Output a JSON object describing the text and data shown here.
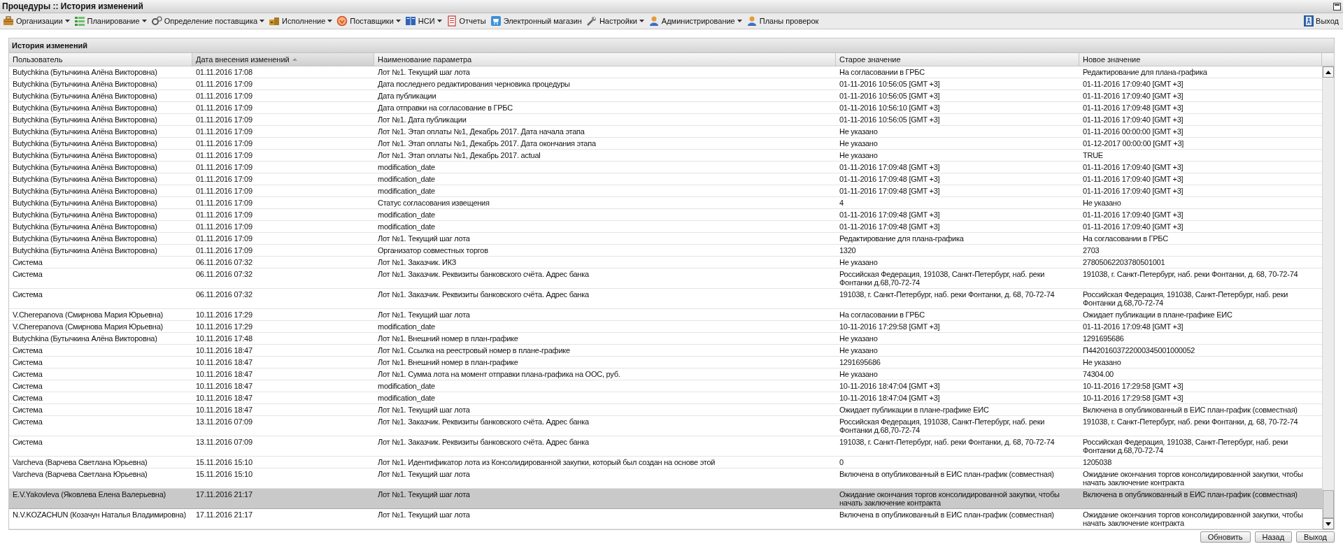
{
  "window": {
    "title": "Процедуры :: История изменений"
  },
  "toolbar": {
    "items": [
      {
        "label": "Организации",
        "dropdown": true
      },
      {
        "label": "Планирование",
        "dropdown": true
      },
      {
        "label": "Определение поставщика",
        "dropdown": true
      },
      {
        "label": "Исполнение",
        "dropdown": true
      },
      {
        "label": "Поставщики",
        "dropdown": true
      },
      {
        "label": "НСИ",
        "dropdown": true
      },
      {
        "label": "Отчеты",
        "dropdown": false
      },
      {
        "label": "Электронный магазин",
        "dropdown": false
      },
      {
        "label": "Настройки",
        "dropdown": true
      },
      {
        "label": "Администрирование",
        "dropdown": true
      },
      {
        "label": "Планы проверок",
        "dropdown": false
      }
    ],
    "exit": "Выход"
  },
  "panel": {
    "title": "История изменений"
  },
  "table": {
    "columns": [
      {
        "label": "Пользователь",
        "sorted": false
      },
      {
        "label": "Дата внесения изменений",
        "sorted": true
      },
      {
        "label": "Наименование параметра",
        "sorted": false
      },
      {
        "label": "Старое значение",
        "sorted": false
      },
      {
        "label": "Новое значение",
        "sorted": false
      }
    ],
    "rows": [
      {
        "user": "Butychkina (Бутычкина Алёна Викторовна)",
        "date": "01.11.2016 17:08",
        "parameter": "Лот №1. Текущий шаг лота",
        "old_value": "На согласовании в ГРБС",
        "new_value": "Редактирование для плана-графика",
        "selected": false
      },
      {
        "user": "Butychkina (Бутычкина Алёна Викторовна)",
        "date": "01.11.2016 17:09",
        "parameter": "Дата последнего редактирования черновика процедуры",
        "old_value": "01-11-2016 10:56:05 [GMT +3]",
        "new_value": "01-11-2016 17:09:40 [GMT +3]",
        "selected": false
      },
      {
        "user": "Butychkina (Бутычкина Алёна Викторовна)",
        "date": "01.11.2016 17:09",
        "parameter": "Дата публикации",
        "old_value": "01-11-2016 10:56:05 [GMT +3]",
        "new_value": "01-11-2016 17:09:40 [GMT +3]",
        "selected": false
      },
      {
        "user": "Butychkina (Бутычкина Алёна Викторовна)",
        "date": "01.11.2016 17:09",
        "parameter": "Дата отправки на согласование в ГРБС",
        "old_value": "01-11-2016 10:56:10 [GMT +3]",
        "new_value": "01-11-2016 17:09:48 [GMT +3]",
        "selected": false
      },
      {
        "user": "Butychkina (Бутычкина Алёна Викторовна)",
        "date": "01.11.2016 17:09",
        "parameter": "Лот №1. Дата публикации",
        "old_value": "01-11-2016 10:56:05 [GMT +3]",
        "new_value": "01-11-2016 17:09:40 [GMT +3]",
        "selected": false
      },
      {
        "user": "Butychkina (Бутычкина Алёна Викторовна)",
        "date": "01.11.2016 17:09",
        "parameter": "Лот №1. Этап оплаты №1, Декабрь 2017. Дата начала этапа",
        "old_value": "Не указано",
        "new_value": "01-11-2016 00:00:00 [GMT +3]",
        "selected": false
      },
      {
        "user": "Butychkina (Бутычкина Алёна Викторовна)",
        "date": "01.11.2016 17:09",
        "parameter": "Лот №1. Этап оплаты №1, Декабрь 2017. Дата окончания этапа",
        "old_value": "Не указано",
        "new_value": "01-12-2017 00:00:00 [GMT +3]",
        "selected": false
      },
      {
        "user": "Butychkina (Бутычкина Алёна Викторовна)",
        "date": "01.11.2016 17:09",
        "parameter": "Лот №1. Этап оплаты №1, Декабрь 2017. actual",
        "old_value": "Не указано",
        "new_value": "TRUE",
        "selected": false
      },
      {
        "user": "Butychkina (Бутычкина Алёна Викторовна)",
        "date": "01.11.2016 17:09",
        "parameter": "modification_date",
        "old_value": "01-11-2016 17:09:48 [GMT +3]",
        "new_value": "01-11-2016 17:09:40 [GMT +3]",
        "selected": false
      },
      {
        "user": "Butychkina (Бутычкина Алёна Викторовна)",
        "date": "01.11.2016 17:09",
        "parameter": "modification_date",
        "old_value": "01-11-2016 17:09:48 [GMT +3]",
        "new_value": "01-11-2016 17:09:40 [GMT +3]",
        "selected": false
      },
      {
        "user": "Butychkina (Бутычкина Алёна Викторовна)",
        "date": "01.11.2016 17:09",
        "parameter": "modification_date",
        "old_value": "01-11-2016 17:09:48 [GMT +3]",
        "new_value": "01-11-2016 17:09:40 [GMT +3]",
        "selected": false
      },
      {
        "user": "Butychkina (Бутычкина Алёна Викторовна)",
        "date": "01.11.2016 17:09",
        "parameter": "Статус согласования извещения",
        "old_value": "4",
        "new_value": "Не указано",
        "selected": false
      },
      {
        "user": "Butychkina (Бутычкина Алёна Викторовна)",
        "date": "01.11.2016 17:09",
        "parameter": "modification_date",
        "old_value": "01-11-2016 17:09:48 [GMT +3]",
        "new_value": "01-11-2016 17:09:40 [GMT +3]",
        "selected": false
      },
      {
        "user": "Butychkina (Бутычкина Алёна Викторовна)",
        "date": "01.11.2016 17:09",
        "parameter": "modification_date",
        "old_value": "01-11-2016 17:09:48 [GMT +3]",
        "new_value": "01-11-2016 17:09:40 [GMT +3]",
        "selected": false
      },
      {
        "user": "Butychkina (Бутычкина Алёна Викторовна)",
        "date": "01.11.2016 17:09",
        "parameter": "Лот №1. Текущий шаг лота",
        "old_value": "Редактирование для плана-графика",
        "new_value": "На согласовании в ГРБС",
        "selected": false
      },
      {
        "user": "Butychkina (Бутычкина Алёна Викторовна)",
        "date": "01.11.2016 17:09",
        "parameter": "Организатор совместных торгов",
        "old_value": "1320",
        "new_value": "2703",
        "selected": false
      },
      {
        "user": "Система",
        "date": "06.11.2016 07:32",
        "parameter": "Лот №1. Заказчик. ИКЗ",
        "old_value": "Не указано",
        "new_value": "27805062203780501001",
        "selected": false
      },
      {
        "user": "Система",
        "date": "06.11.2016 07:32",
        "parameter": "Лот №1. Заказчик. Реквизиты банковского счёта. Адрес банка",
        "old_value": "Российская Федерация, 191038, Санкт-Петербург, наб. реки Фонтанки д.68,70-72-74",
        "new_value": "191038, г. Санкт-Петербург, наб. реки Фонтанки, д. 68, 70-72-74",
        "selected": false
      },
      {
        "user": "Система",
        "date": "06.11.2016 07:32",
        "parameter": "Лот №1. Заказчик. Реквизиты банковского счёта. Адрес банка",
        "old_value": "191038, г. Санкт-Петербург, наб. реки Фонтанки, д. 68, 70-72-74",
        "new_value": "Российская Федерация, 191038, Санкт-Петербург, наб. реки Фонтанки д.68,70-72-74",
        "selected": false
      },
      {
        "user": "V.Cherepanova (Смирнова Мария Юрьевна)",
        "date": "10.11.2016 17:29",
        "parameter": "Лот №1. Текущий шаг лота",
        "old_value": "На согласовании в ГРБС",
        "new_value": "Ожидает публикации в плане-графике ЕИС",
        "selected": false
      },
      {
        "user": "V.Cherepanova (Смирнова Мария Юрьевна)",
        "date": "10.11.2016 17:29",
        "parameter": "modification_date",
        "old_value": "10-11-2016 17:29:58 [GMT +3]",
        "new_value": "01-11-2016 17:09:48 [GMT +3]",
        "selected": false
      },
      {
        "user": "Butychkina (Бутычкина Алёна Викторовна)",
        "date": "10.11.2016 17:48",
        "parameter": "Лот №1. Внешний номер в план-графике",
        "old_value": "Не указано",
        "new_value": "1291695686",
        "selected": false
      },
      {
        "user": "Система",
        "date": "10.11.2016 18:47",
        "parameter": "Лот №1. Ссылка на реестровый номер в плане-графике",
        "old_value": "Не указано",
        "new_value": "П44201603722000345001000052",
        "selected": false
      },
      {
        "user": "Система",
        "date": "10.11.2016 18:47",
        "parameter": "Лот №1. Внешний номер в план-графике",
        "old_value": "1291695686",
        "new_value": "Не указано",
        "selected": false
      },
      {
        "user": "Система",
        "date": "10.11.2016 18:47",
        "parameter": "Лот №1. Сумма лота на момент отправки плана-графика на ООС, руб.",
        "old_value": "Не указано",
        "new_value": "74304.00",
        "selected": false
      },
      {
        "user": "Система",
        "date": "10.11.2016 18:47",
        "parameter": "modification_date",
        "old_value": "10-11-2016 18:47:04 [GMT +3]",
        "new_value": "10-11-2016 17:29:58 [GMT +3]",
        "selected": false
      },
      {
        "user": "Система",
        "date": "10.11.2016 18:47",
        "parameter": "modification_date",
        "old_value": "10-11-2016 18:47:04 [GMT +3]",
        "new_value": "10-11-2016 17:29:58 [GMT +3]",
        "selected": false
      },
      {
        "user": "Система",
        "date": "10.11.2016 18:47",
        "parameter": "Лот №1. Текущий шаг лота",
        "old_value": "Ожидает публикации в плане-графике ЕИС",
        "new_value": "Включена в опубликованный в ЕИС план-график (совместная)",
        "selected": false
      },
      {
        "user": "Система",
        "date": "13.11.2016 07:09",
        "parameter": "Лот №1. Заказчик. Реквизиты банковского счёта. Адрес банка",
        "old_value": "Российская Федерация, 191038, Санкт-Петербург, наб. реки Фонтанки д.68,70-72-74",
        "new_value": "191038, г. Санкт-Петербург, наб. реки Фонтанки, д. 68, 70-72-74",
        "selected": false
      },
      {
        "user": "Система",
        "date": "13.11.2016 07:09",
        "parameter": "Лот №1. Заказчик. Реквизиты банковского счёта. Адрес банка",
        "old_value": "191038, г. Санкт-Петербург, наб. реки Фонтанки, д. 68, 70-72-74",
        "new_value": "Российская Федерация, 191038, Санкт-Петербург, наб. реки Фонтанки д.68,70-72-74",
        "selected": false
      },
      {
        "user": "Varcheva (Варчева Светлана Юрьевна)",
        "date": "15.11.2016 15:10",
        "parameter": "Лот №1. Идентификатор лота из Консолидированной закупки, который был создан на основе этой",
        "old_value": "0",
        "new_value": "1205038",
        "selected": false
      },
      {
        "user": "Varcheva (Варчева Светлана Юрьевна)",
        "date": "15.11.2016 15:10",
        "parameter": "Лот №1. Текущий шаг лота",
        "old_value": "Включена в опубликованный в ЕИС план-график (совместная)",
        "new_value": "Ожидание окончания торгов консолидированной закупки, чтобы начать заключение контракта",
        "selected": false
      },
      {
        "user": "E.V.Yakovleva (Яковлева Елена Валерьевна)",
        "date": "17.11.2016 21:17",
        "parameter": "Лот №1. Текущий шаг лота",
        "old_value": "Ожидание окончания торгов консолидированной закупки, чтобы начать заключение контракта",
        "new_value": "Включена в опубликованный в ЕИС план-график (совместная)",
        "selected": true
      },
      {
        "user": "N.V.KOZACHUN (Козачун Наталья Владимировна)",
        "date": "17.11.2016 21:17",
        "parameter": "Лот №1. Текущий шаг лота",
        "old_value": "Включена в опубликованный в ЕИС план-график (совместная)",
        "new_value": "Ожидание окончания торгов консолидированной закупки, чтобы начать заключение контракта",
        "selected": false
      }
    ]
  },
  "buttons": [
    "Обновить",
    "Назад",
    "Выход"
  ]
}
